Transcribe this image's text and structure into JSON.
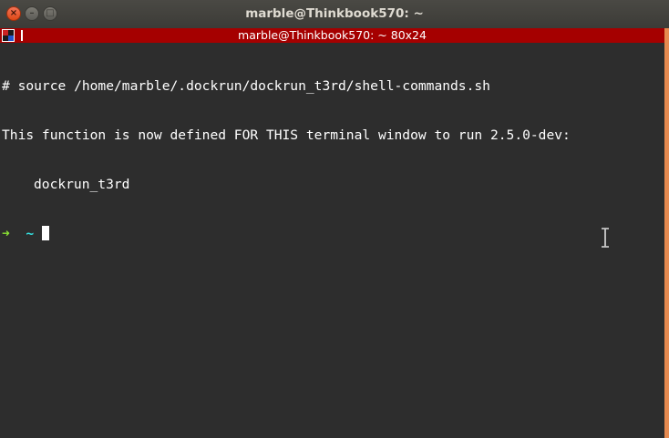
{
  "window": {
    "title": "marble@Thinkbook570: ~",
    "buttons": {
      "close": "×",
      "minimize": "–",
      "maximize": "□"
    }
  },
  "tmux": {
    "title": "marble@Thinkbook570: ~ 80x24",
    "bar_color": "#a50000"
  },
  "terminal": {
    "lines": [
      "# source /home/marble/.dockrun/dockrun_t3rd/shell-commands.sh",
      "This function is now defined FOR THIS terminal window to run 2.5.0-dev:",
      "dockrun_t3rd"
    ],
    "prompt": {
      "arrow": "➜",
      "dir": "~"
    },
    "background": "#2d2d2d"
  },
  "icons": [
    "close-icon",
    "minimize-icon",
    "maximize-icon",
    "tmux-pane-icon",
    "text-cursor-icon"
  ]
}
